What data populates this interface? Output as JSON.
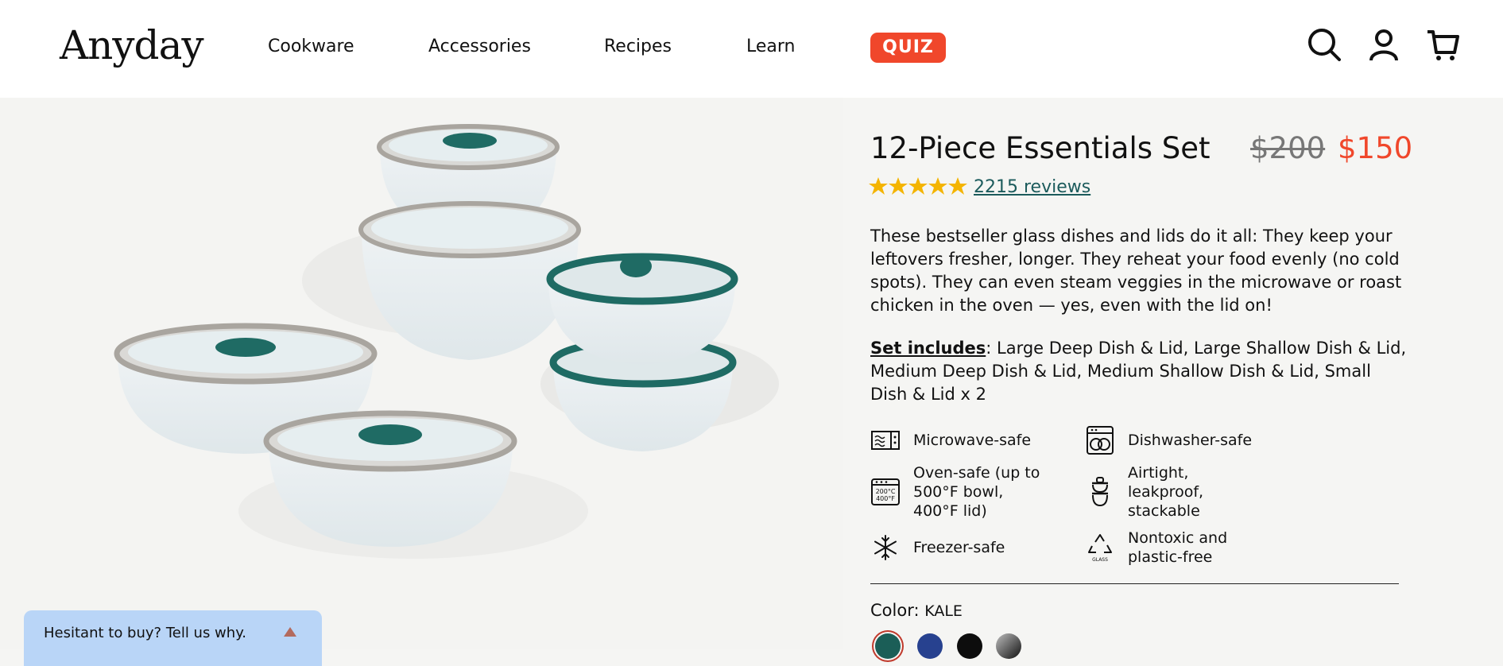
{
  "header": {
    "logo": "Anyday",
    "nav": [
      "Cookware",
      "Accessories",
      "Recipes",
      "Learn"
    ],
    "quiz_label": "QUIZ"
  },
  "product": {
    "title": "12-Piece Essentials Set",
    "price_old": "$200",
    "price_new": "$150",
    "rating": 5,
    "reviews_label": "2215 reviews",
    "description": "These bestseller glass dishes and lids do it all: They keep your leftovers fresher, longer. They reheat your food evenly (no cold spots). They can even steam veggies in the microwave or roast chicken in the oven — yes, even with the lid on!",
    "includes_label": "Set includes",
    "includes_text": ": Large Deep Dish & Lid, Large Shallow Dish & Lid, Medium Deep Dish & Lid, Medium Shallow Dish & Lid, Small Dish & Lid x 2",
    "features": [
      {
        "icon": "microwave-icon",
        "lines": [
          "Microwave-safe"
        ]
      },
      {
        "icon": "dishwasher-icon",
        "lines": [
          "Dishwasher-safe"
        ]
      },
      {
        "icon": "oven-icon",
        "lines": [
          "Oven-safe (up to",
          "500°F bowl,",
          "400°F lid)"
        ],
        "icon_text": [
          "200°C",
          "400°F"
        ]
      },
      {
        "icon": "stack-icon",
        "lines": [
          "Airtight,",
          "leakproof,",
          "stackable"
        ]
      },
      {
        "icon": "snowflake-icon",
        "lines": [
          "Freezer-safe"
        ]
      },
      {
        "icon": "recycle-icon",
        "lines": [
          "Nontoxic and",
          "plastic-free"
        ],
        "icon_text": [
          "GLASS"
        ]
      }
    ],
    "color_label": "Color: ",
    "color_value": "KALE",
    "swatches": [
      {
        "name": "kale",
        "color": "#1b5e57",
        "selected": true
      },
      {
        "name": "blue",
        "color": "#27418f",
        "selected": false
      },
      {
        "name": "black",
        "color": "#0d0d0d",
        "selected": false
      },
      {
        "name": "gradient",
        "color": "#555555",
        "selected": false
      }
    ]
  },
  "feedback": {
    "text": "Hesitant to buy? Tell us why."
  },
  "colors": {
    "accent": "#f0472b",
    "teal": "#1c5b5c",
    "star": "#f4b400",
    "feedback_bg": "#b9d5f7"
  }
}
